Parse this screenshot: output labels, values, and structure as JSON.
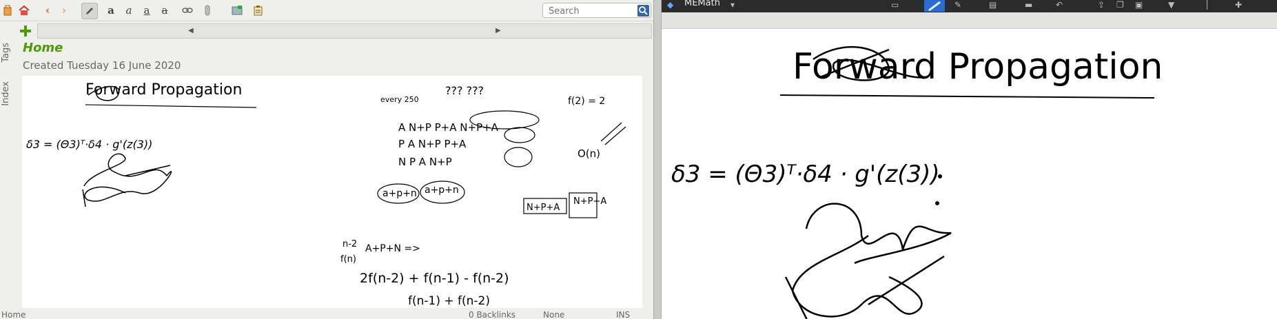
{
  "zim": {
    "search": {
      "placeholder": "Search"
    },
    "page": {
      "title": "Home",
      "created": "Created Tuesday 16 June 2020"
    },
    "side_tabs": {
      "tags": "Tags",
      "index": "Index"
    },
    "status": {
      "page": "Home",
      "backlinks": "0 Backlinks",
      "style": "None",
      "mode": "INS"
    },
    "toolbar_icons": [
      "home-icon",
      "back-icon",
      "forward-icon",
      "edit-pen-icon",
      "bold-icon",
      "italic-icon",
      "underline-icon",
      "strikethrough-icon",
      "link-icon",
      "attachment-icon",
      "insert-image-icon",
      "clipboard-icon"
    ]
  },
  "mypaint": {
    "title": "MEMath",
    "handwriting": {
      "title": "Forward Propagation",
      "equation": "δ3 = (Θ3)ᵀ·δ4 · g'(z(3))"
    }
  },
  "notes_left": {
    "title": "Forward Propagation",
    "equation": "δ3 = (Θ3)ᵀ·δ4 · g'(z(3))",
    "scribbles": [
      "every 250",
      "??? ???",
      "f(2) = 2",
      "A  N+P  P+A  N+P+A",
      "P  A  N+P  P+A",
      "N  P  A  N+P",
      "a+p+n",
      "a+p+n",
      "n-2",
      "f(n)",
      "A+P+N =>",
      "2f(n-2) + f(n-1) - f(n-2)",
      "f(n-1) + f(n-2)",
      "O(n)",
      "N+P+A",
      "N+P+A"
    ]
  },
  "colors": {
    "accent_green": "#4e9a06",
    "selection_blue": "#2a6dd2",
    "titlebar_dark": "#2b2b2b"
  }
}
